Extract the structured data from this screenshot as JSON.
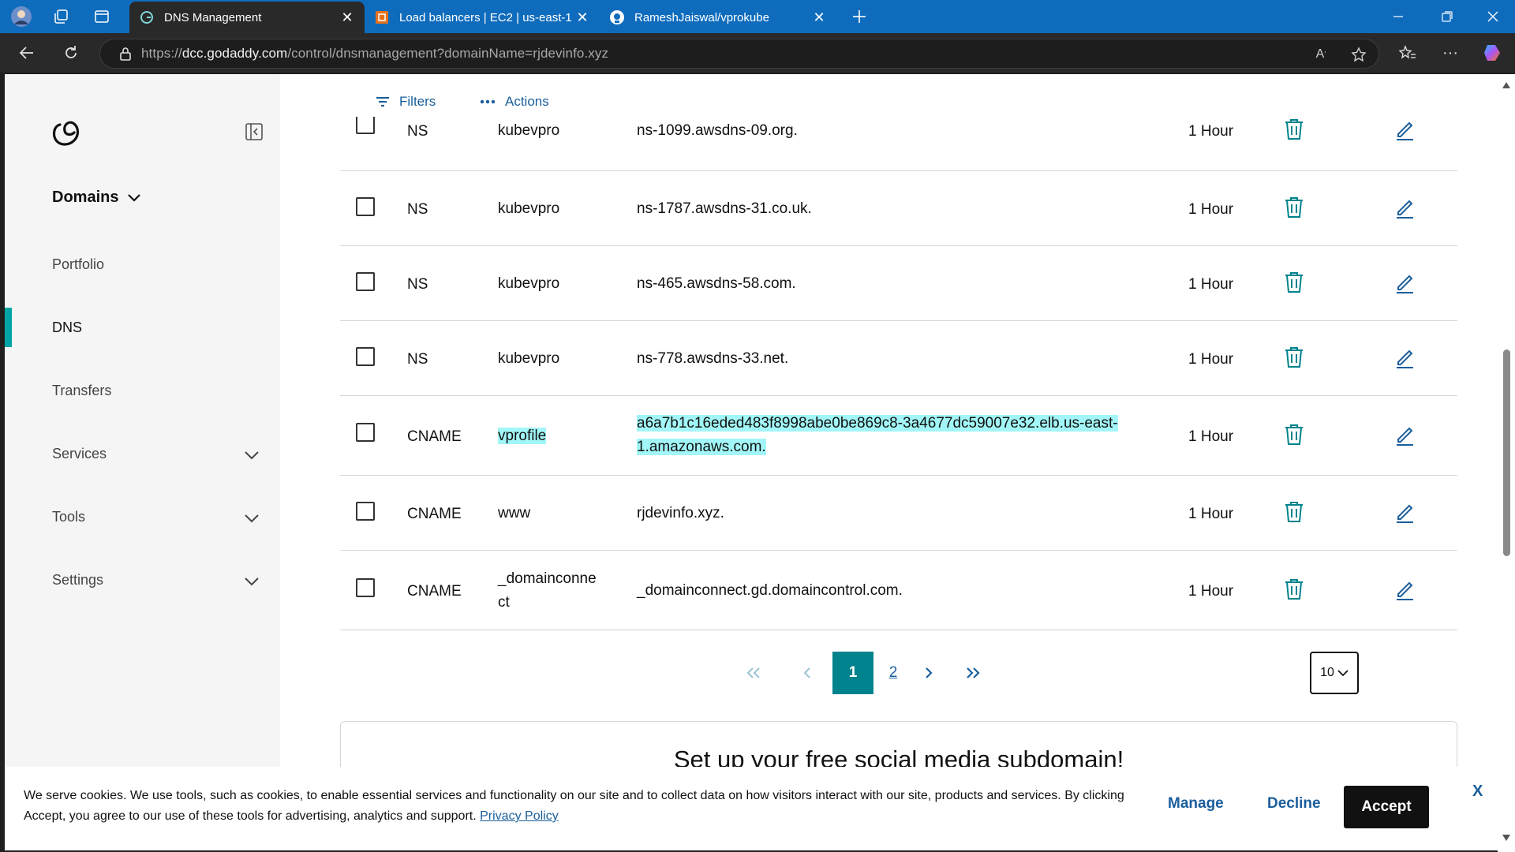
{
  "browser": {
    "tabs": [
      {
        "title": "DNS Management",
        "icon": "godaddy-icon",
        "active": true
      },
      {
        "title": "Load balancers | EC2 | us-east-1",
        "icon": "aws-icon",
        "active": false
      },
      {
        "title": "RameshJaiswal/vprokube",
        "icon": "github-icon",
        "active": false
      }
    ],
    "url_prefix": "https://",
    "url_host": "dcc.godaddy.com",
    "url_path": "/control/dnsmanagement?domainName=rjdevinfo.xyz",
    "accent": "#0f6cbd"
  },
  "sidebar": {
    "section": "Domains",
    "items": [
      {
        "label": "Portfolio"
      },
      {
        "label": "DNS",
        "active": true
      },
      {
        "label": "Transfers"
      },
      {
        "label": "Services"
      },
      {
        "label": "Tools"
      },
      {
        "label": "Settings"
      }
    ],
    "accent": "#00a4a6"
  },
  "toolbar": {
    "filters": "Filters",
    "actions": "Actions"
  },
  "records": [
    {
      "type": "NS",
      "name": "kubevpro",
      "value": "ns-1099.awsdns-09.org.",
      "ttl": "1 Hour"
    },
    {
      "type": "NS",
      "name": "kubevpro",
      "value": "ns-1787.awsdns-31.co.uk.",
      "ttl": "1 Hour"
    },
    {
      "type": "NS",
      "name": "kubevpro",
      "value": "ns-465.awsdns-58.com.",
      "ttl": "1 Hour"
    },
    {
      "type": "NS",
      "name": "kubevpro",
      "value": "ns-778.awsdns-33.net.",
      "ttl": "1 Hour"
    },
    {
      "type": "CNAME",
      "name": "vprofile",
      "value_line1": "a6a7b1c16eded483f8998abe0be869c8-3a4677dc59007e32.elb.us-east-",
      "value_line2": "1.amazonaws.com.",
      "ttl": "1 Hour",
      "highlighted": true
    },
    {
      "type": "CNAME",
      "name": "www",
      "value": "rjdevinfo.xyz.",
      "ttl": "1 Hour"
    },
    {
      "type": "CNAME",
      "name_line1": "_domainconne",
      "name_line2": "ct",
      "value": "_domainconnect.gd.domaincontrol.com.",
      "ttl": "1 Hour"
    }
  ],
  "pagination": {
    "current": "1",
    "next_page": "2",
    "page_size": "10"
  },
  "promo": {
    "title": "Set up your free social media subdomain!"
  },
  "cookie": {
    "text": "We serve cookies. We use tools, such as cookies, to enable essential services and functionality on our site and to collect data on how visitors interact with our site, products and services. By clicking Accept, you agree to our use of these tools for advertising, analytics and support.",
    "privacy_link": "Privacy Policy",
    "manage": "Manage",
    "decline": "Decline",
    "accept": "Accept",
    "close": "X"
  }
}
